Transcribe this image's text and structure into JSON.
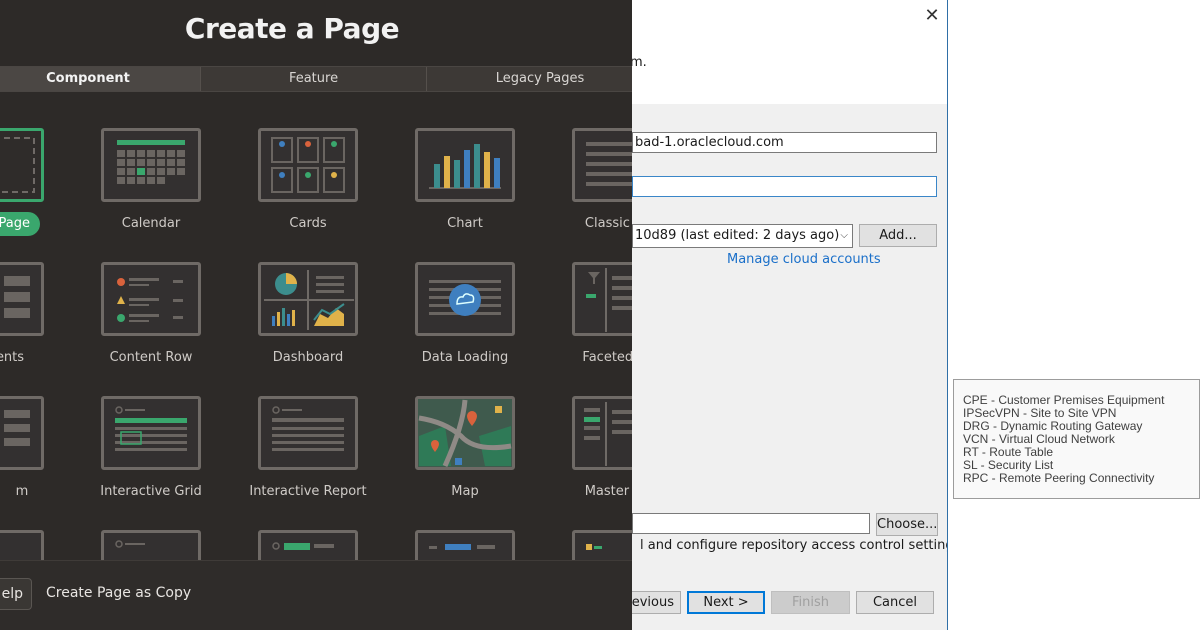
{
  "apex": {
    "title": "Create a Page",
    "tabs": [
      "Component",
      "Feature",
      "Legacy Pages"
    ],
    "tiles": [
      {
        "label": "Page",
        "icon": "blank-page-icon",
        "selected": true
      },
      {
        "label": "Calendar",
        "icon": "calendar-icon"
      },
      {
        "label": "Cards",
        "icon": "cards-icon"
      },
      {
        "label": "Chart",
        "icon": "chart-icon"
      },
      {
        "label": "Classic R",
        "icon": "classic-report-icon"
      },
      {
        "label": "ents",
        "icon": "components-icon"
      },
      {
        "label": "Content Row",
        "icon": "content-row-icon"
      },
      {
        "label": "Dashboard",
        "icon": "dashboard-icon"
      },
      {
        "label": "Data Loading",
        "icon": "data-loading-icon"
      },
      {
        "label": "Faceted S",
        "icon": "faceted-search-icon"
      },
      {
        "label": "m",
        "icon": "form-icon"
      },
      {
        "label": "Interactive Grid",
        "icon": "interactive-grid-icon"
      },
      {
        "label": "Interactive Report",
        "icon": "interactive-report-icon"
      },
      {
        "label": "Map",
        "icon": "map-icon"
      },
      {
        "label": "Master D",
        "icon": "master-detail-icon"
      },
      {
        "label": "",
        "icon": "list-icon"
      },
      {
        "label": "",
        "icon": "search-list-icon"
      },
      {
        "label": "",
        "icon": "smart-filters-icon"
      },
      {
        "label": "",
        "icon": "tree-icon"
      },
      {
        "label": "",
        "icon": "wizard-icon"
      }
    ],
    "footer": {
      "help": "elp",
      "copy": "Create Page as Copy"
    }
  },
  "wizard": {
    "close_icon": "close-icon",
    "description": "m.",
    "server_value": "bad-1.oraclecloud.com",
    "focused_value": "",
    "account_value": "10d89 (last edited: 2 days ago)",
    "add_button": "Add...",
    "manage_link": "Manage cloud accounts",
    "path_value": "",
    "choose_button": "Choose...",
    "note": "l and configure repository access control settings for",
    "buttons": {
      "previous": "evious",
      "next": "Next >",
      "finish": "Finish",
      "cancel": "Cancel"
    }
  },
  "tooltip": {
    "lines": [
      "CPE - Customer Premises Equipment",
      "IPSecVPN - Site to Site VPN",
      "DRG - Dynamic Routing Gateway",
      "VCN - Virtual Cloud Network",
      "RT - Route Table",
      "SL - Security List",
      "RPC - Remote Peering Connectivity"
    ]
  },
  "colors": {
    "dark_bg": "#2d2a28",
    "accent_green": "#3aa76d",
    "chart_teal": "#3c8d8d",
    "chart_yellow": "#e0b24a",
    "chart_blue": "#3f7fbf",
    "dialog_blue": "#0078d7",
    "link_blue": "#1a6fc9"
  }
}
